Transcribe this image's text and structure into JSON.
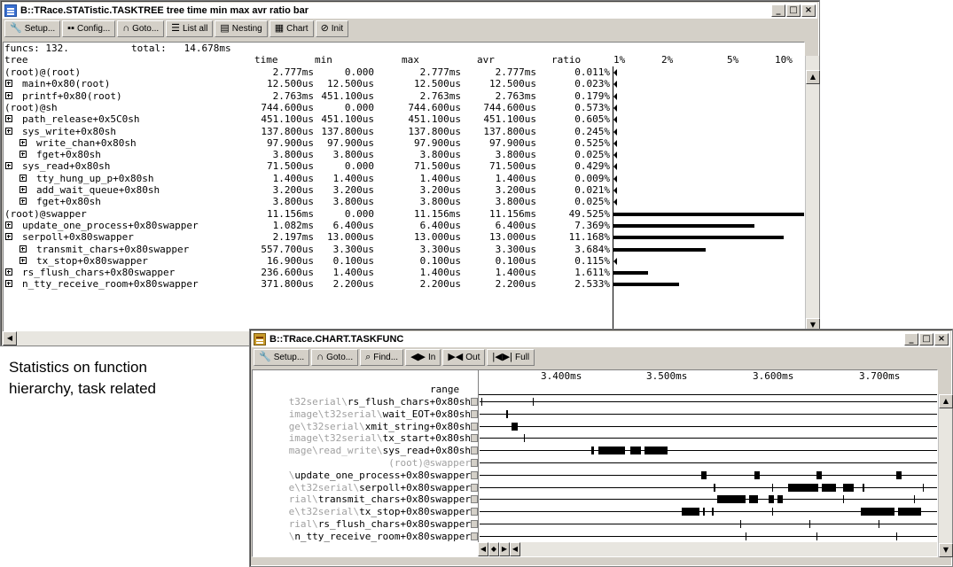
{
  "stat_window": {
    "title": "B::TRace.STATistic.TASKTREE tree time min max avr ratio bar",
    "toolbar": [
      {
        "label": "Setup...",
        "icon": "setup-icon"
      },
      {
        "label": "Config...",
        "icon": "config-icon"
      },
      {
        "label": "Goto...",
        "icon": "goto-icon"
      },
      {
        "label": "List all",
        "icon": "list-icon"
      },
      {
        "label": "Nesting",
        "icon": "nesting-icon"
      },
      {
        "label": "Chart",
        "icon": "chart-icon"
      },
      {
        "label": "Init",
        "icon": "init-icon"
      }
    ],
    "summary_funcs": "funcs: 132.",
    "summary_total": "total:   14.678ms",
    "columns": {
      "tree": "tree",
      "time": "time",
      "min": "min",
      "max": "max",
      "avr": "avr",
      "ratio": "ratio",
      "s1": "1%",
      "s2": "2%",
      "s5": "5%",
      "s10": "10%"
    },
    "rows": [
      {
        "tree": "(root)@(root)",
        "time": "2.777ms",
        "min": "0.000",
        "max": "2.777ms",
        "avr": "2.777ms",
        "ratio": "0.011%",
        "bar": 0.011
      },
      {
        "tree": "main+0x80(root)",
        "time": "12.500us",
        "min": "12.500us",
        "max": "12.500us",
        "avr": "12.500us",
        "ratio": "0.023%",
        "bar": 0.023
      },
      {
        "tree": "printf+0x80(root)",
        "time": "2.763ms",
        "min": "451.100us",
        "max": "2.763ms",
        "avr": "2.763ms",
        "ratio": "0.179%",
        "bar": 0.179
      },
      {
        "tree": "(root)@sh",
        "time": "744.600us",
        "min": "0.000",
        "max": "744.600us",
        "avr": "744.600us",
        "ratio": "0.573%",
        "bar": 0.573
      },
      {
        "tree": "path_release+0x5C0sh",
        "time": "451.100us",
        "min": "451.100us",
        "max": "451.100us",
        "avr": "451.100us",
        "ratio": "0.605%",
        "bar": 0.605
      },
      {
        "tree": "sys_write+0x80sh",
        "time": "137.800us",
        "min": "137.800us",
        "max": "137.800us",
        "avr": "137.800us",
        "ratio": "0.245%",
        "bar": 0.245
      },
      {
        "tree": "write_chan+0x80sh",
        "time": "97.900us",
        "min": "97.900us",
        "max": "97.900us",
        "avr": "97.900us",
        "ratio": "0.525%",
        "bar": 0.525
      },
      {
        "tree": "fget+0x80sh",
        "time": "3.800us",
        "min": "3.800us",
        "max": "3.800us",
        "avr": "3.800us",
        "ratio": "0.025%",
        "bar": 0.025
      },
      {
        "tree": "sys_read+0x80sh",
        "time": "71.500us",
        "min": "0.000",
        "max": "71.500us",
        "avr": "71.500us",
        "ratio": "0.429%",
        "bar": 0.429
      },
      {
        "tree": "tty_hung_up_p+0x80sh",
        "time": "1.400us",
        "min": "1.400us",
        "max": "1.400us",
        "avr": "1.400us",
        "ratio": "0.009%",
        "bar": 0.009
      },
      {
        "tree": "add_wait_queue+0x80sh",
        "time": "3.200us",
        "min": "3.200us",
        "max": "3.200us",
        "avr": "3.200us",
        "ratio": "0.021%",
        "bar": 0.021
      },
      {
        "tree": "fget+0x80sh",
        "time": "3.800us",
        "min": "3.800us",
        "max": "3.800us",
        "avr": "3.800us",
        "ratio": "0.025%",
        "bar": 0.025
      },
      {
        "tree": "(root)@swapper",
        "time": "11.156ms",
        "min": "0.000",
        "max": "11.156ms",
        "avr": "11.156ms",
        "ratio": "49.525%",
        "bar": 49.525
      },
      {
        "tree": "update_one_process+0x80swapper",
        "time": "1.082ms",
        "min": "6.400us",
        "max": "6.400us",
        "avr": "6.400us",
        "ratio": "7.369%",
        "bar": 7.369
      },
      {
        "tree": "serpoll+0x80swapper",
        "time": "2.197ms",
        "min": "13.000us",
        "max": "13.000us",
        "avr": "13.000us",
        "ratio": "11.168%",
        "bar": 11.168
      },
      {
        "tree": "transmit_chars+0x80swapper",
        "time": "557.700us",
        "min": "3.300us",
        "max": "3.300us",
        "avr": "3.300us",
        "ratio": "3.684%",
        "bar": 3.684
      },
      {
        "tree": "tx_stop+0x80swapper",
        "time": "16.900us",
        "min": "0.100us",
        "max": "0.100us",
        "avr": "0.100us",
        "ratio": "0.115%",
        "bar": 0.115
      },
      {
        "tree": "rs_flush_chars+0x80swapper",
        "time": "236.600us",
        "min": "1.400us",
        "max": "1.400us",
        "avr": "1.400us",
        "ratio": "1.611%",
        "bar": 1.611
      },
      {
        "tree": "n_tty_receive_room+0x80swapper",
        "time": "371.800us",
        "min": "2.200us",
        "max": "2.200us",
        "avr": "2.200us",
        "ratio": "2.533%",
        "bar": 2.533
      }
    ]
  },
  "chart_window": {
    "title": "B::TRace.CHART.TASKFUNC",
    "toolbar": [
      {
        "label": "Setup...",
        "icon": "setup-icon"
      },
      {
        "label": "Goto...",
        "icon": "goto-icon"
      },
      {
        "label": "Find...",
        "icon": "find-icon"
      },
      {
        "label": "In",
        "icon": "zoom-in-icon"
      },
      {
        "label": "Out",
        "icon": "zoom-out-icon"
      },
      {
        "label": "Full",
        "icon": "zoom-full-icon"
      }
    ],
    "range_label": "range",
    "time_ticks": [
      "3.400ms",
      "3.500ms",
      "3.600ms",
      "3.700ms"
    ],
    "rows": [
      {
        "path": "t32serial\\",
        "func": "rs_flush_chars+0x80sh"
      },
      {
        "path": "image\\t32serial\\",
        "func": "wait_EOT+0x80sh"
      },
      {
        "path": "ge\\t32serial\\",
        "func": "xmit_string+0x80sh"
      },
      {
        "path": "image\\t32serial\\",
        "func": "tx_start+0x80sh"
      },
      {
        "path": "mage\\read_write\\",
        "func": "sys_read+0x80sh"
      },
      {
        "path": "(root)@swapper",
        "func": ""
      },
      {
        "path": "\\",
        "func": "update_one_process+0x80swapper"
      },
      {
        "path": "e\\t32serial\\",
        "func": "serpoll+0x80swapper"
      },
      {
        "path": "rial\\",
        "func": "transmit_chars+0x80swapper"
      },
      {
        "path": "e\\t32serial\\",
        "func": "tx_stop+0x80swapper"
      },
      {
        "path": "rial\\",
        "func": "rs_flush_chars+0x80swapper"
      },
      {
        "path": "\\",
        "func": "n_tty_receive_room+0x80swapper"
      }
    ]
  },
  "caption": {
    "line1": "Statistics on function",
    "line2": "hierarchy, task related"
  }
}
